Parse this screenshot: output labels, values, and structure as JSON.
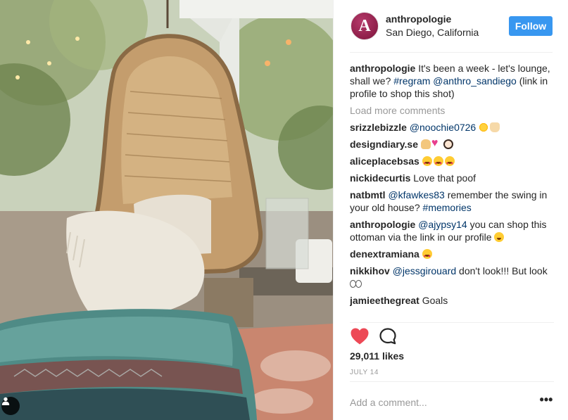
{
  "post": {
    "username": "anthropologie",
    "avatar_letter": "A",
    "location": "San Diego, California",
    "follow_label": "Follow",
    "caption": {
      "username": "anthropologie",
      "text1": " It's been a week - let's lounge, shall we? ",
      "hashtag": "#regram",
      "mention": "@anthro_sandiego",
      "text2": " (link in profile to shop this shot)"
    },
    "load_more": "Load more comments",
    "comments": [
      {
        "username": "srizzlebizzle",
        "mention": "@noochie0726",
        "text": " "
      },
      {
        "username": "designdiary.se",
        "text": " "
      },
      {
        "username": "aliceplacebsas",
        "text": " "
      },
      {
        "username": "nickidecurtis",
        "text": " Love that poof"
      },
      {
        "username": "natbmtl",
        "mention": "@kfawkes83",
        "text": " remember the swing in your old house? ",
        "hashtag": "#memories"
      },
      {
        "username": "anthropologie",
        "mention": "@ajypsy14",
        "text": " you can shop this ottoman via the link in our profile "
      },
      {
        "username": "denextramiana",
        "text": " "
      },
      {
        "username": "nikkihov",
        "mention": "@jessgirouard",
        "text": " don't look!!! But look "
      },
      {
        "username": "jamieethegreat",
        "text": " Goals"
      }
    ],
    "likes": "29,011 likes",
    "date": "JULY 14",
    "add_comment_placeholder": "Add a comment...",
    "more_label": "•••"
  },
  "colors": {
    "accent": "#3897f0",
    "liked_heart": "#ed4956",
    "link": "#003569",
    "muted": "#999999"
  },
  "icons": {
    "like": "heart-filled-icon",
    "comment": "speech-bubble-icon",
    "user_tag": "person-icon",
    "more": "ellipsis-icon"
  }
}
